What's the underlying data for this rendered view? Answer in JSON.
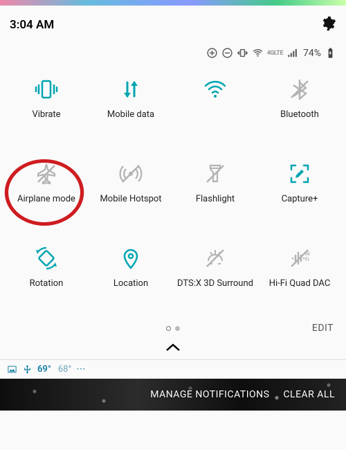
{
  "statusbar": {
    "time": "3:04 AM",
    "battery": "74%"
  },
  "tiles": [
    {
      "label": "Vibrate"
    },
    {
      "label": "Mobile data"
    },
    {
      "label": ""
    },
    {
      "label": "Bluetooth"
    },
    {
      "label": "Airplane mode"
    },
    {
      "label": "Mobile Hotspot"
    },
    {
      "label": "Flashlight"
    },
    {
      "label": "Capture+"
    },
    {
      "label": "Rotation"
    },
    {
      "label": "Location"
    },
    {
      "label": "DTS:X 3D Surround"
    },
    {
      "label": "Hi-Fi Quad DAC"
    }
  ],
  "footer": {
    "edit": "EDIT",
    "manage": "MANAGE NOTIFICATIONS",
    "clear": "CLEAR ALL"
  },
  "weather": {
    "temp_now": "69°",
    "temp_alt": "68°"
  },
  "network_label": "4GLTE"
}
